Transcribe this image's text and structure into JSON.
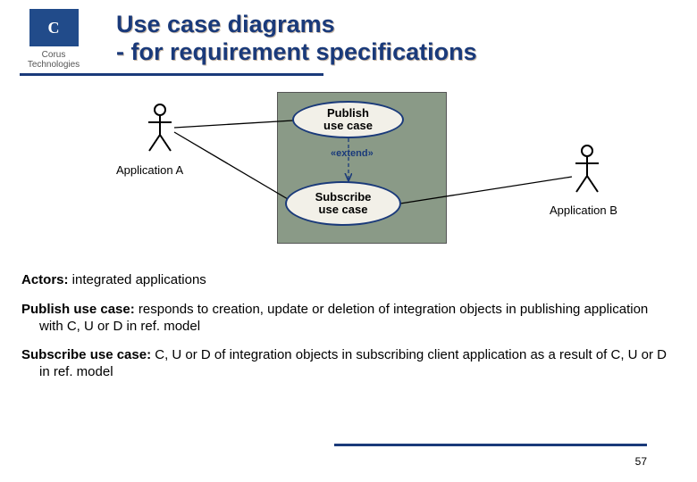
{
  "logo": {
    "letter": "C",
    "brand": "Corus Technologies"
  },
  "title": {
    "line1": "Use case diagrams",
    "line2": "- for requirement specifications"
  },
  "diagram": {
    "actor_a": "Application A",
    "actor_b": "Application B",
    "usecase_publish_l1": "Publish",
    "usecase_publish_l2": "use case",
    "usecase_subscribe_l1": "Subscribe",
    "usecase_subscribe_l2": "use case",
    "extend": "«extend»"
  },
  "descriptions": {
    "actors_label": "Actors:",
    "actors_text": " integrated applications",
    "publish_label": "Publish use case:",
    "publish_text": " responds to creation, update or deletion of integration objects in publishing application with C, U or D in ref. model",
    "subscribe_label": "Subscribe use case:",
    "subscribe_text": " C, U or D  of integration objects in subscribing client application as a result of C, U or D in ref. model"
  },
  "page": "57"
}
